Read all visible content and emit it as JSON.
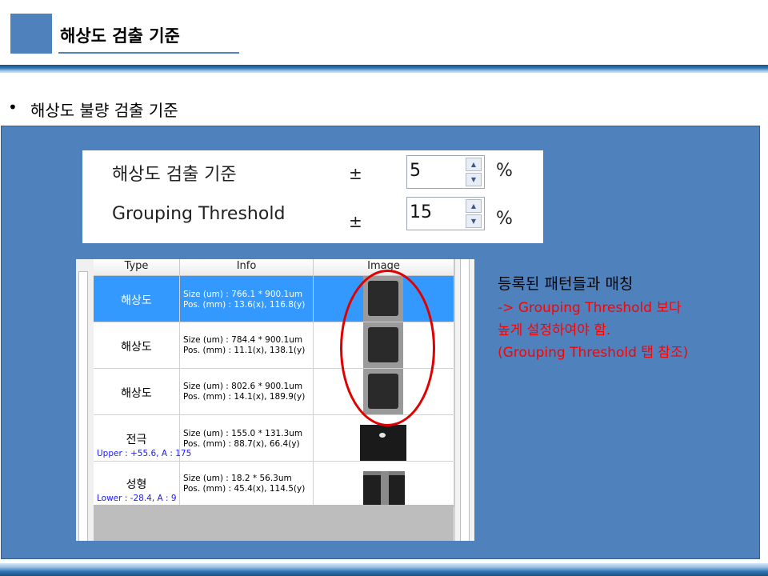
{
  "header": {
    "title": "해상도 검출 기준"
  },
  "bullet": {
    "marker": "•",
    "text": "해상도 불량 검출 기준"
  },
  "settings": {
    "rows": [
      {
        "label": "해상도 검출 기준",
        "pm": "±",
        "value": "5",
        "unit": "%"
      },
      {
        "label": "Grouping Threshold",
        "pm": "±",
        "value": "15",
        "unit": "%"
      }
    ],
    "spin_up": "▲",
    "spin_down": "▼"
  },
  "grid": {
    "columns": [
      "Type",
      "Info",
      "Image"
    ],
    "rows": [
      {
        "type": "해상도",
        "sub": "",
        "info1": "Size (um) : 766.1 * 900.1um",
        "info2": "Pos. (mm) : 13.6(x), 116.8(y)",
        "selected": true
      },
      {
        "type": "해상도",
        "sub": "",
        "info1": "Size (um) : 784.4 * 900.1um",
        "info2": "Pos. (mm) : 11.1(x), 138.1(y)",
        "selected": false
      },
      {
        "type": "해상도",
        "sub": "",
        "info1": "Size (um) : 802.6 * 900.1um",
        "info2": "Pos. (mm) : 14.1(x), 189.9(y)",
        "selected": false
      },
      {
        "type": "전극",
        "sub": "Upper : +55.6, A : 175",
        "info1": "Size (um) : 155.0 * 131.3um",
        "info2": "Pos. (mm) : 88.7(x), 66.4(y)",
        "selected": false
      },
      {
        "type": "성형",
        "sub": "Lower : -28.4, A : 9",
        "info1": "Size (um) : 18.2 * 56.3um",
        "info2": "Pos. (mm) : 45.4(x), 114.5(y)",
        "selected": false
      }
    ]
  },
  "note": {
    "title": "등록된 패턴들과 매칭",
    "lines": [
      "-> Grouping Threshold 보다",
      "높게 설정하여야 함.",
      "(Grouping Threshold 탭 참조)"
    ],
    "color": "#ff0000"
  },
  "colors": {
    "accent": "#4f81bd",
    "selection": "#3399ff",
    "highlight": "#e00000"
  }
}
